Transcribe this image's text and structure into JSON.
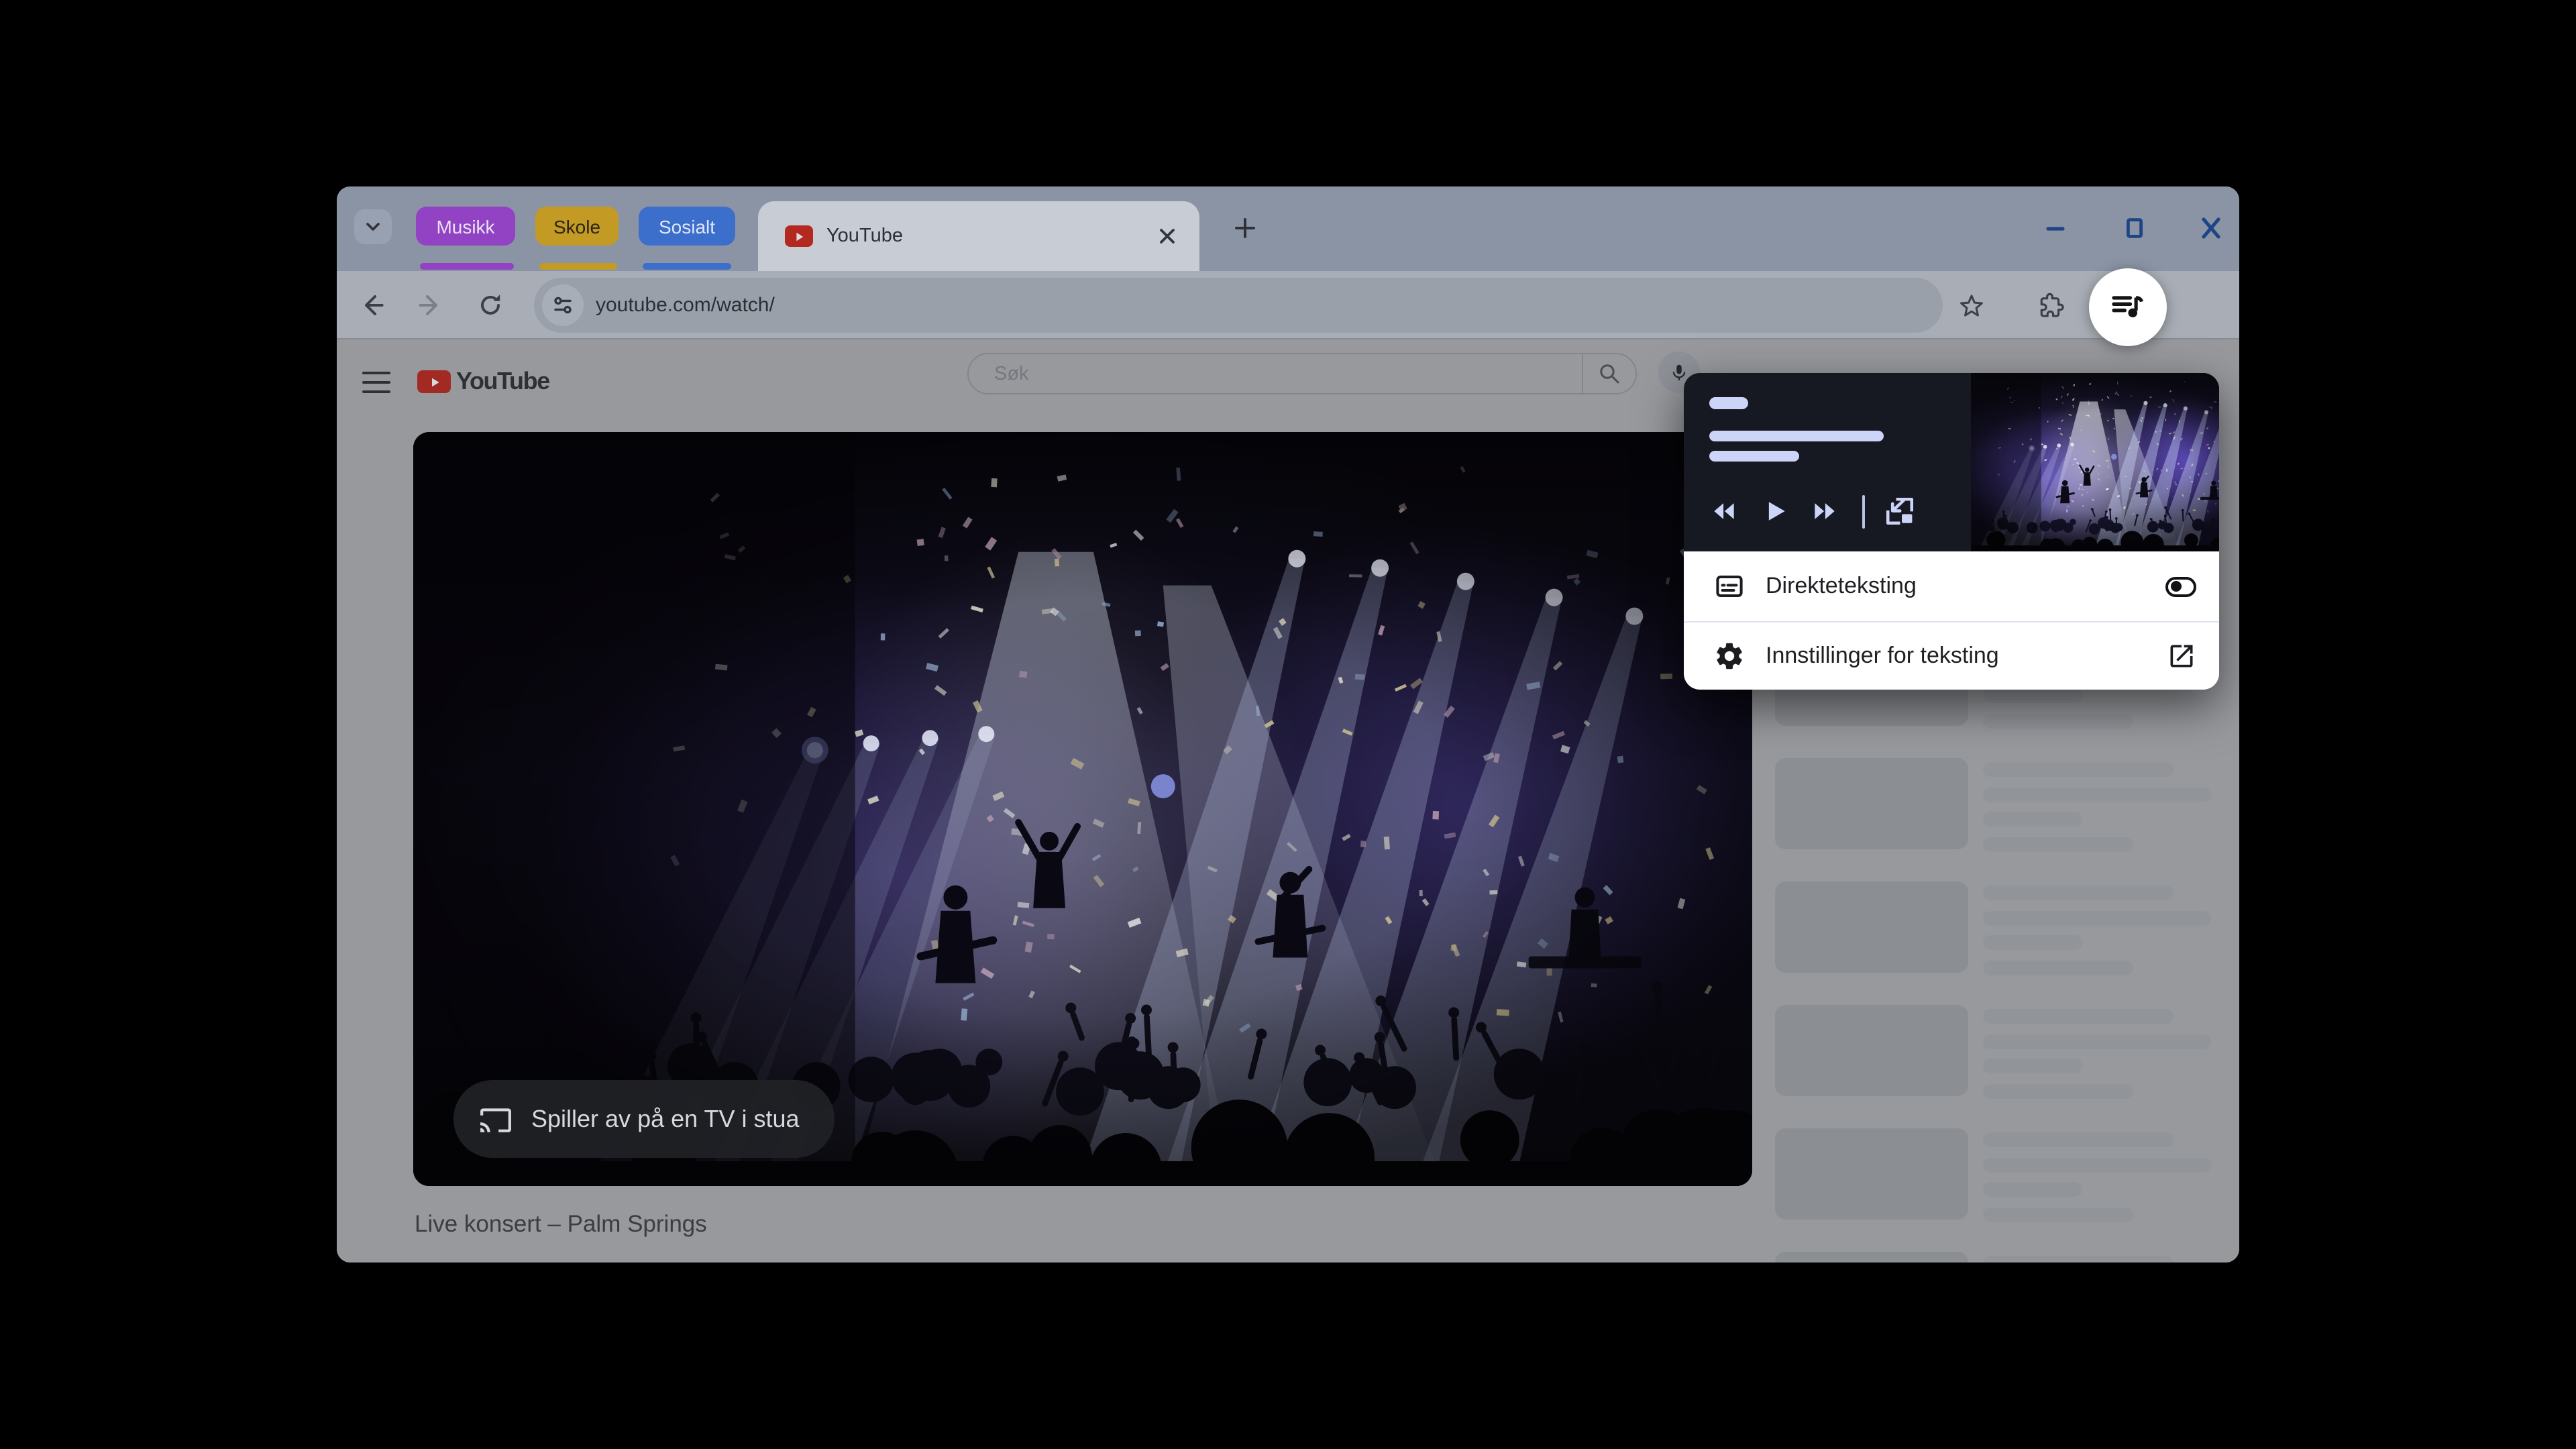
{
  "window": {
    "controls": {
      "minimize": "minimize-icon",
      "maximize": "maximize-icon",
      "close": "close-icon"
    }
  },
  "tab_strip": {
    "overflow_button_icon": "chevron-down-icon",
    "groups": [
      {
        "label": "Musikk",
        "color": "#9143c4",
        "text_color": "#e9e2f3"
      },
      {
        "label": "Skole",
        "color": "#c39a23",
        "text_color": "#2b2517"
      },
      {
        "label": "Sosialt",
        "color": "#3c6ecb",
        "text_color": "#dfe7f6"
      }
    ],
    "active_tab": {
      "title": "YouTube",
      "favicon": "youtube-icon"
    },
    "new_tab_icon": "plus-icon"
  },
  "toolbar": {
    "back_icon": "arrow-left-icon",
    "forward_icon": "arrow-right-icon",
    "reload_icon": "reload-icon",
    "site_controls_icon": "tune-icon",
    "url": "youtube.com/watch/",
    "bookmark_icon": "star-icon",
    "extensions_icon": "puzzle-icon",
    "media_controls_icon": "queue-music-icon",
    "avatar": "profile-avatar"
  },
  "page": {
    "menu_icon": "hamburger-icon",
    "brand": "YouTube",
    "search": {
      "placeholder": "Søk",
      "button_icon": "magnifier-icon",
      "mic_icon": "mic-icon"
    },
    "video": {
      "cast_overlay": {
        "icon": "cast-icon",
        "text": "Spiller av på en TV i stua"
      },
      "title": "Live konsert – Palm Springs"
    },
    "sidebar": {
      "skeleton_items": 7
    }
  },
  "media_popup": {
    "player": {
      "controls": [
        "rewind-icon",
        "play-icon",
        "fast-forward-icon",
        "pip-icon"
      ],
      "thumbnail": "concert-thumbnail"
    },
    "rows": [
      {
        "icon": "captions-icon",
        "label": "Direkteteksting",
        "control": "toggle",
        "state": "off"
      },
      {
        "icon": "gear-icon",
        "label": "Innstillinger for teksting",
        "control": "open-in-new-icon"
      }
    ]
  },
  "colors": {
    "tab_strip_bg": "#8b94a5",
    "active_tab_bg": "#c7ccd5",
    "toolbar_bg": "#a9aeb6",
    "omnibox_bg": "#9aa0aa",
    "window_controls": "#1d4586",
    "page_bg_dimmed": "#97999d",
    "youtube_red_dimmed": "#a32a22",
    "popup_card_bg": "#171922",
    "popup_pill": "#ccd4f8",
    "cast_pill_bg": "#1f2126"
  }
}
